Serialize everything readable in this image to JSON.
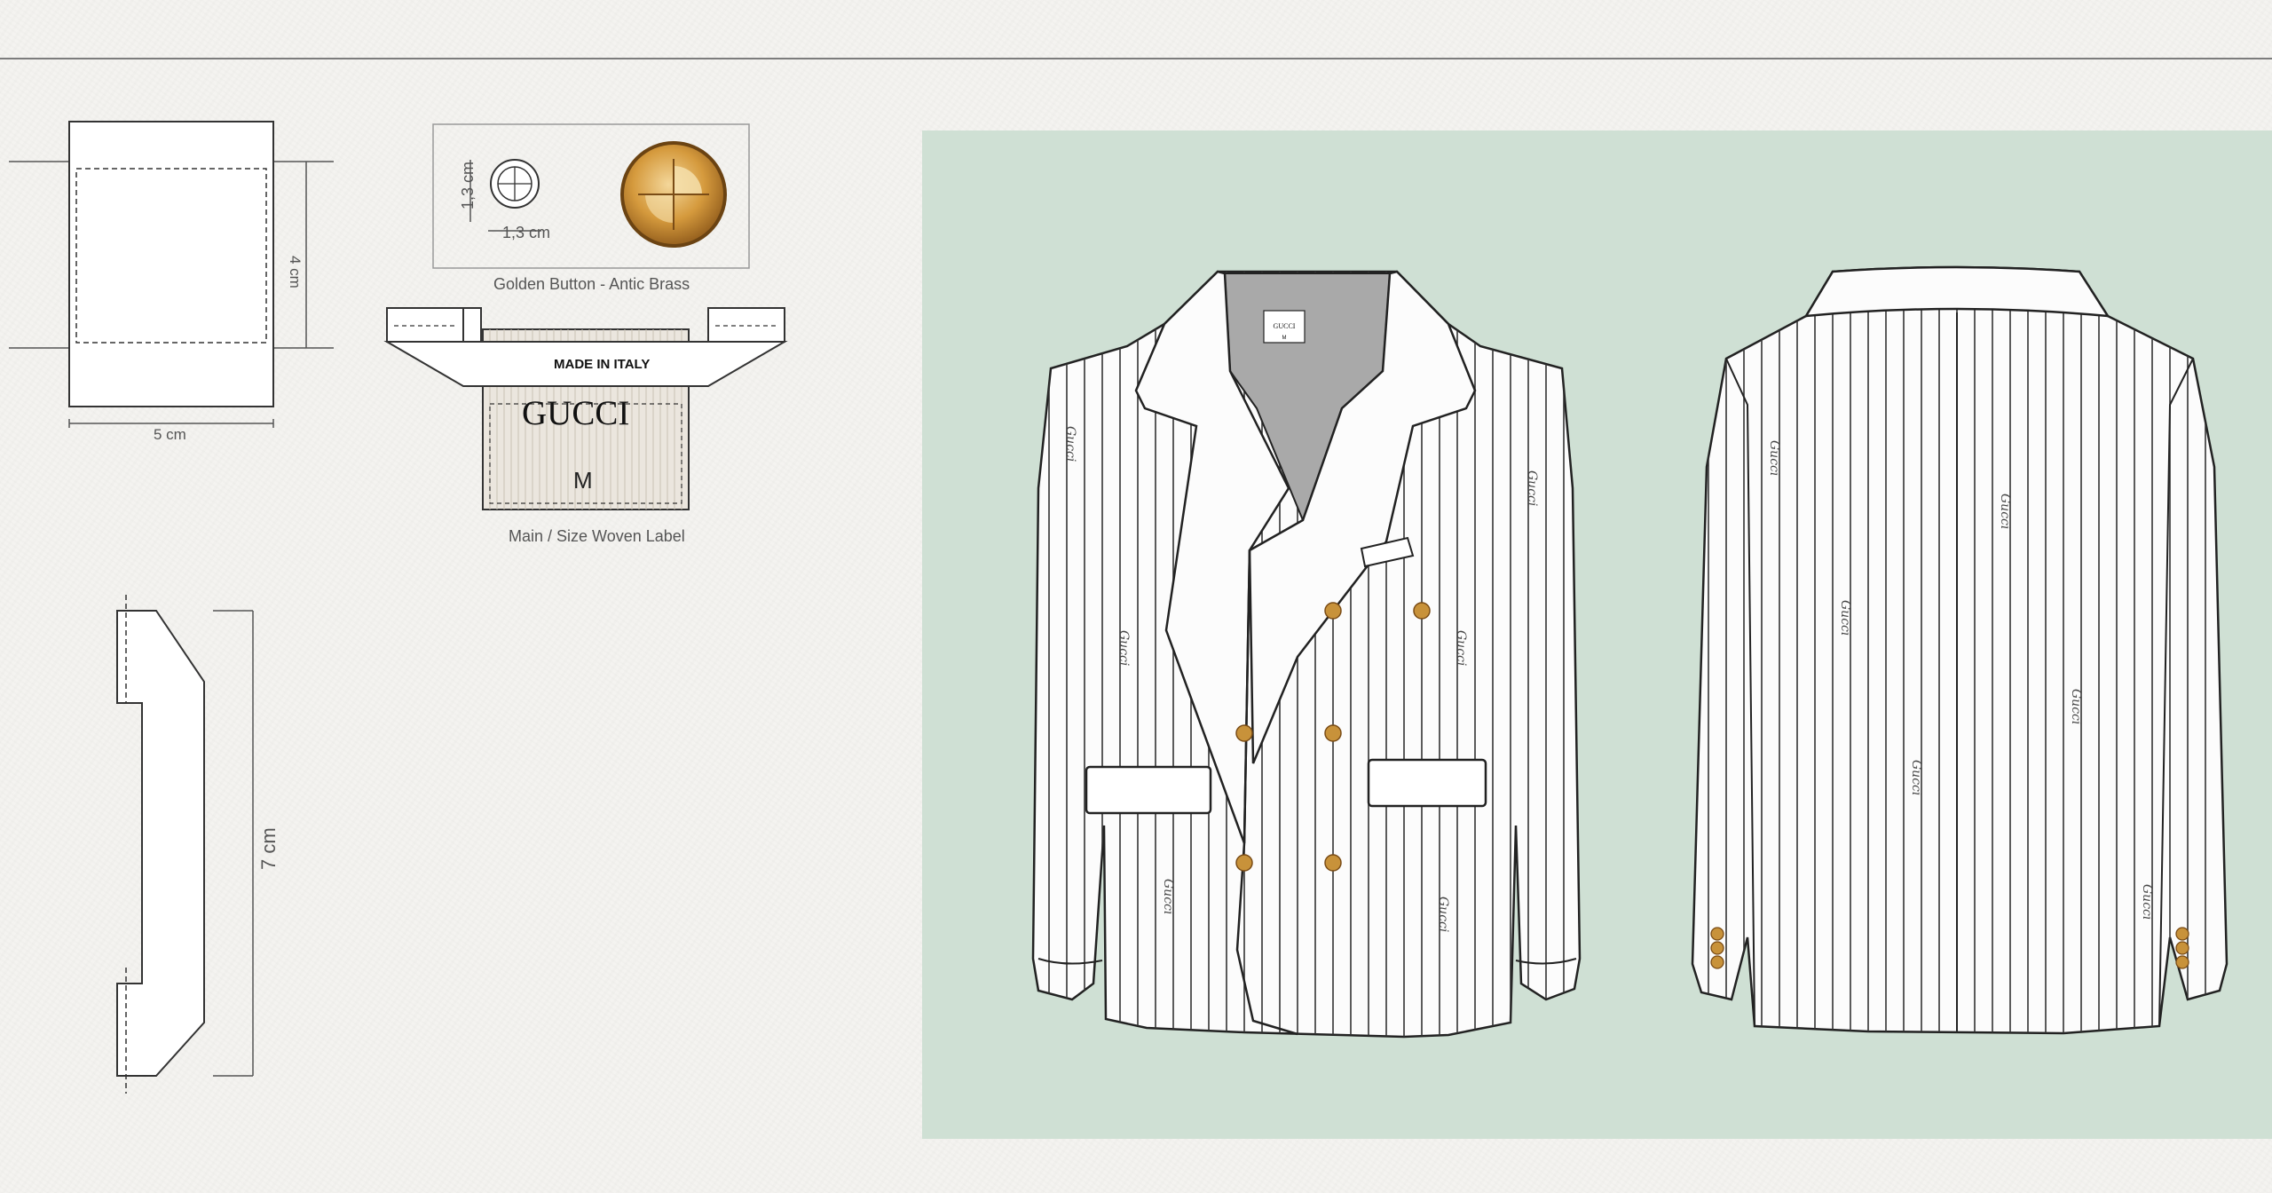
{
  "pocket_flap": {
    "width_label": "5 cm",
    "height_label": "4 cm"
  },
  "button": {
    "height_label": "1,3 cm",
    "width_label": "1,3 cm",
    "caption": "Golden Button - Antic Brass"
  },
  "woven_label": {
    "made_in": "MADE IN ITALY",
    "brand": "GUCCI",
    "size": "M",
    "caption": "Main / Size Woven Label"
  },
  "hanger_loop": {
    "length_label": "7 cm"
  },
  "jacket_front": {
    "neck_label_brand": "GUCCI",
    "neck_label_size": "M",
    "print_text": "Gucci"
  },
  "jacket_back": {
    "print_text": "Gucci"
  },
  "colors": {
    "panel_bg": "#cfe0d4",
    "paper": "#f4f3f0",
    "button_gold": "#c8923a",
    "line": "#222222"
  }
}
